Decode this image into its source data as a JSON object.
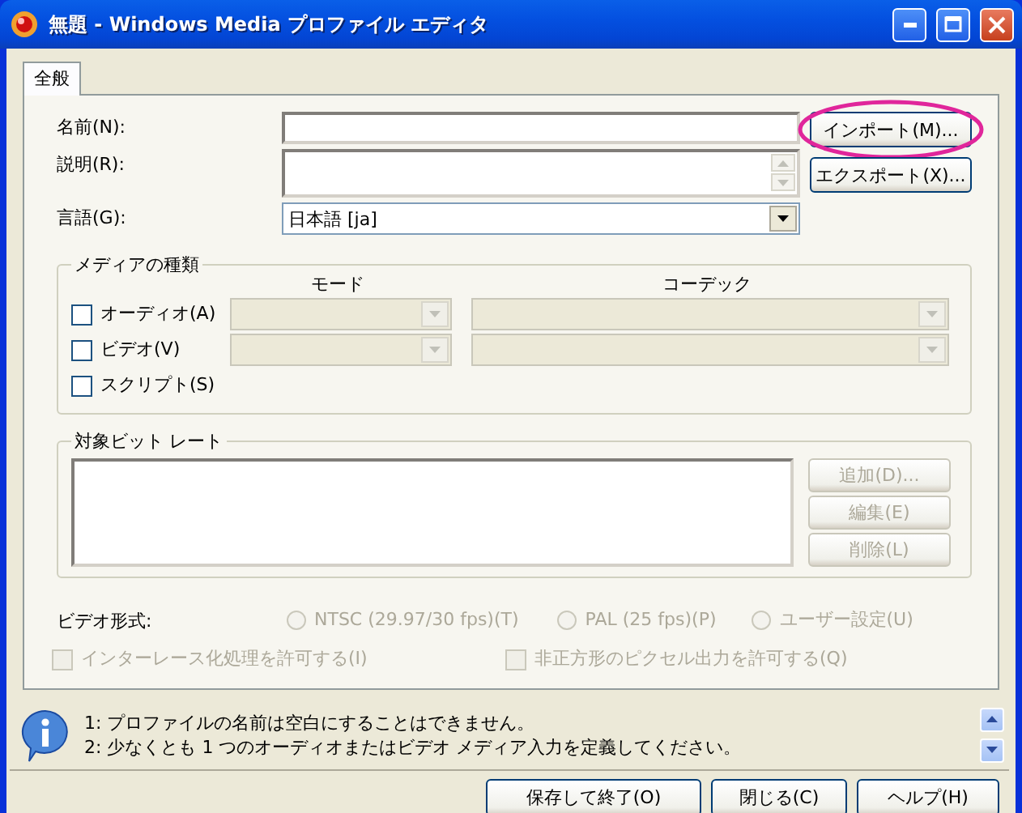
{
  "window": {
    "title": "無題 - Windows Media プロファイル エディタ"
  },
  "tabs": [
    {
      "label": "全般",
      "selected": true
    }
  ],
  "fields": [
    {
      "kind": "text",
      "label": "名前(N):"
    },
    {
      "kind": "textarea",
      "label": "説明(R):"
    },
    {
      "kind": "select",
      "label": "言語(G):",
      "value": "日本語 [ja]"
    }
  ],
  "side_buttons": [
    {
      "label": "インポート(M)...",
      "highlighted": true
    },
    {
      "label": "エクスポート(X)...",
      "highlighted": false
    }
  ],
  "media_types": {
    "title": "メディアの種類",
    "columns": [
      "モード",
      "コーデック"
    ],
    "rows": [
      {
        "kind": "combo",
        "label": "オーディオ(A)",
        "checked": false
      },
      {
        "kind": "combo",
        "label": "ビデオ(V)",
        "checked": false
      },
      {
        "kind": "plain",
        "label": "スクリプト(S)",
        "checked": false
      }
    ]
  },
  "bitrate": {
    "title": "対象ビット レート",
    "buttons": [
      {
        "label": "追加(D)...",
        "disabled": true
      },
      {
        "label": "編集(E)",
        "disabled": true
      },
      {
        "label": "削除(L)",
        "disabled": true
      }
    ]
  },
  "video_format": {
    "label": "ビデオ形式:",
    "options": [
      {
        "label": "NTSC (29.97/30 fps)(T)",
        "selected": false,
        "disabled": true
      },
      {
        "label": "PAL (25 fps)(P)",
        "selected": false,
        "disabled": true
      },
      {
        "label": "ユーザー設定(U)",
        "selected": false,
        "disabled": true
      }
    ]
  },
  "options": [
    {
      "label": "インターレース化処理を許可する(I)",
      "checked": false,
      "disabled": true
    },
    {
      "label": "非正方形のピクセル出力を許可する(Q)",
      "checked": false,
      "disabled": true
    }
  ],
  "messages": [
    "1: プロファイルの名前は空白にすることはできません。",
    "2: 少なくとも 1 つのオーディオまたはビデオ メディア入力を定義してください。"
  ],
  "buttons": [
    {
      "label": "保存して終了(O)"
    },
    {
      "label": "閉じる(C)"
    },
    {
      "label": "ヘルプ(H)"
    }
  ]
}
